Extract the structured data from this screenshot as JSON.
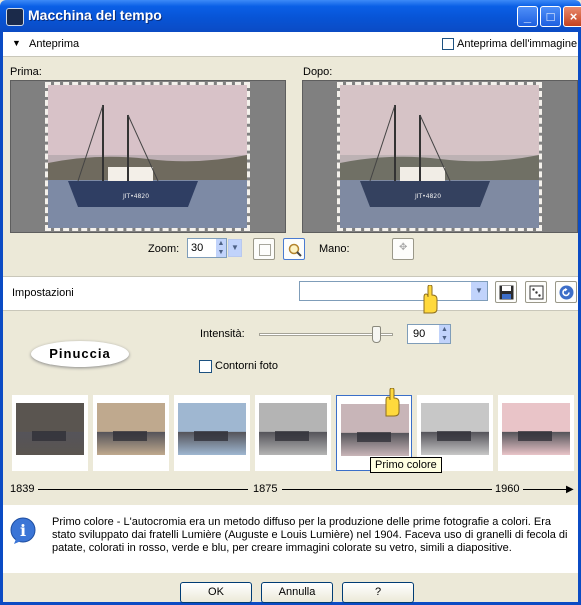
{
  "window": {
    "title": "Macchina del tempo"
  },
  "preview": {
    "toggle_label": "Anteprima",
    "image_preview_label": "Anteprima dell'immagine",
    "before_label": "Prima:",
    "after_label": "Dopo:",
    "boat_name": "JIT•4820"
  },
  "zoom": {
    "label": "Zoom:",
    "value": "30"
  },
  "hand": {
    "label": "Mano:"
  },
  "settings": {
    "label": "Impostazioni",
    "preset_value": ""
  },
  "intensity": {
    "label": "Intensità:",
    "value": "90",
    "slider_fraction": 0.9
  },
  "frame_option": {
    "label": "Contorni foto"
  },
  "watermark": "Pinuccia",
  "thumbnails": [
    {
      "name": "thumb-1839",
      "tint": "#5a5550"
    },
    {
      "name": "thumb-sepia",
      "tint": "#bfa98e"
    },
    {
      "name": "thumb-cyanotype",
      "tint": "#9fb7d1"
    },
    {
      "name": "thumb-bw",
      "tint": "#b4b4b4"
    },
    {
      "name": "thumb-primo-colore",
      "tint": "#c8b5b8"
    },
    {
      "name": "thumb-bw-2",
      "tint": "#c7c7c7"
    },
    {
      "name": "thumb-1960",
      "tint": "#e9c4c8"
    }
  ],
  "tooltip": "Primo colore",
  "timeline": {
    "left": "1839",
    "mid": "1875",
    "right": "1960"
  },
  "info_text": "Primo colore - L'autocromia era un metodo diffuso per la produzione delle prime fotografie a colori. Era stato sviluppato dai fratelli Lumière (Auguste e Louis Lumière) nel 1904. Faceva uso di granelli di fecola di patate, colorati in rosso, verde e blu, per creare immagini colorate su vetro, simili a diapositive.",
  "buttons": {
    "ok": "OK",
    "cancel": "Annulla",
    "help": "?"
  }
}
